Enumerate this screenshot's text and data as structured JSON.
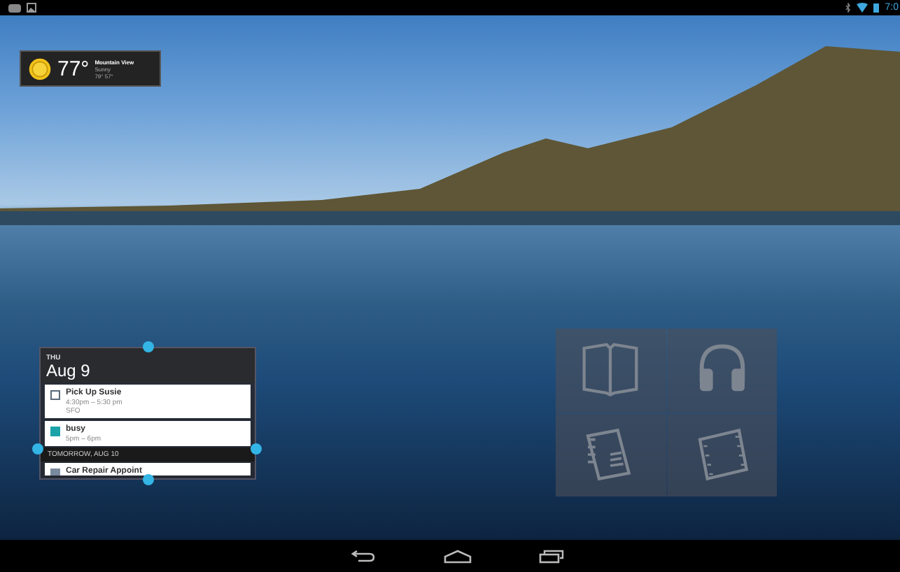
{
  "status_bar": {
    "clock": "7:0"
  },
  "weather": {
    "temperature": "77°",
    "location": "Mountain View",
    "condition": "Sunny",
    "high_low": "79° 57°"
  },
  "calendar": {
    "weekday": "THU",
    "date": "Aug 9",
    "events": [
      {
        "title": "Pick Up Susie",
        "time": "4:30pm – 5:30 pm",
        "location": "SFO",
        "kind": "outline",
        "color": "#5a6a7a"
      },
      {
        "title": "busy",
        "time": "5pm – 6pm",
        "kind": "filled",
        "color": "#1aa3a8"
      }
    ],
    "day_header": "TOMORROW, AUG 10",
    "next_events": [
      {
        "title": "Car Repair Appoint",
        "kind": "filled",
        "color": "#7a8a9e"
      }
    ]
  },
  "folder": {
    "apps": [
      {
        "kind": "book"
      },
      {
        "kind": "music"
      },
      {
        "kind": "magazine"
      },
      {
        "kind": "movie"
      }
    ]
  }
}
